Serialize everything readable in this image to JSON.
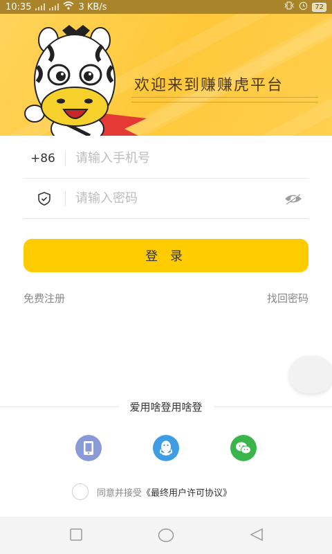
{
  "status_bar": {
    "time": "10:35",
    "speed": "3 KB/s",
    "battery": "72"
  },
  "banner": {
    "welcome_text": "欢迎来到赚赚虎平台",
    "mascot_icon": "zebra-mascot-icon"
  },
  "login_form": {
    "country_code": "+86",
    "phone_placeholder": "请输入手机号",
    "password_placeholder": "请输入密码",
    "login_label": "登 录",
    "register_label": "免费注册",
    "recover_label": "找回密码"
  },
  "social_login": {
    "title": "爱用啥登用啥登",
    "options": [
      "phone-login-icon",
      "qq-icon",
      "wechat-icon"
    ]
  },
  "agreement": {
    "prefix": "同意并接受",
    "protocol": "《最终用户许可协议》"
  },
  "colors": {
    "accent": "#ffcc00",
    "banner": "#ffc83a",
    "qq": "#3d9ee6",
    "wechat": "#3ab54a",
    "phone": "#8a9ad6"
  }
}
